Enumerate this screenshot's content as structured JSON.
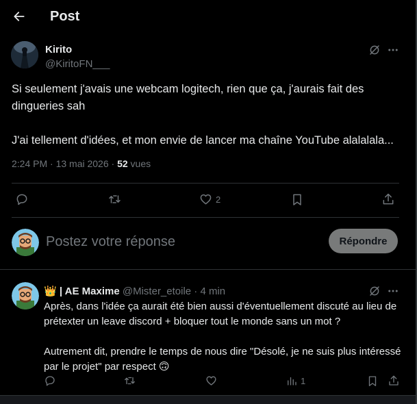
{
  "header": {
    "title": "Post",
    "back_icon": "arrow-left-icon"
  },
  "post": {
    "author_name": "Kirito",
    "author_handle": "@KiritoFN___",
    "text": "Si seulement j'avais une webcam logitech, rien que ça, j'aurais fait des dingueries sah\n\nJ'ai tellement d'idées, et mon envie de lancer ma chaîne YouTube alalalala...",
    "time": "2:24 PM · 13 mai 2026 · ",
    "views_count": "52",
    "views_label": " vues",
    "actions": {
      "like_count": "2"
    }
  },
  "composer": {
    "placeholder": "Postez votre réponse",
    "button_label": "Répondre"
  },
  "reply": {
    "name_prefix_emoji": "👑",
    "author_name": "| AE Maxime",
    "author_handle": "@Mister_etoile",
    "time": " · 4 min",
    "text": "Après, dans l'idée ça aurait été bien aussi d'éventuellement discuté au lieu de prétexter un leave discord + bloquer tout le monde sans un mot ?\n\nAutrement dit, prendre le temps de nous dire \"Désolé, je ne suis plus intéressé par le projet\" par respect 🙃",
    "views_count": "1"
  },
  "colors": {
    "background": "#000000",
    "text": "#e7e9ea",
    "secondary": "#71767b",
    "divider": "#2f3336",
    "reply_button": "#787a7a"
  }
}
